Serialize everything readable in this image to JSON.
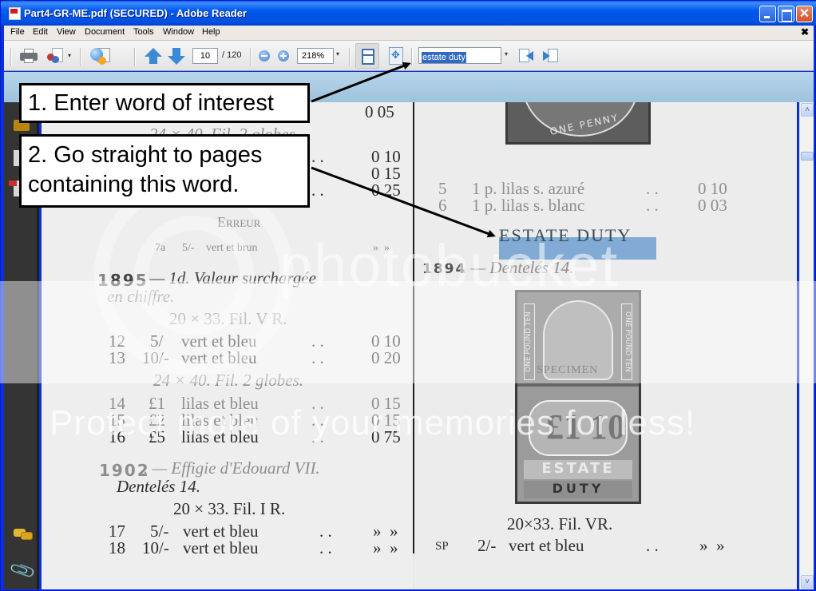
{
  "window": {
    "title": "Part4-GR-ME.pdf (SECURED) - Adobe Reader",
    "controls": [
      "minimize",
      "maximize",
      "close"
    ],
    "close_glyph": "✕"
  },
  "menubar": {
    "items": [
      "File",
      "Edit",
      "View",
      "Document",
      "Tools",
      "Window",
      "Help"
    ],
    "doc_close_glyph": "✖"
  },
  "toolbar": {
    "current_page": "10",
    "total_pages": "/ 120",
    "zoom_level": "218%",
    "search_value": "estate duty",
    "dropdown_glyph": "▾",
    "icons": [
      "printer-icon",
      "collaborate-icon",
      "secure-globe-icon",
      "previous-page-icon",
      "next-page-icon",
      "zoom-out-icon",
      "zoom-in-icon",
      "fit-width-icon",
      "full-screen-icon",
      "find-previous-icon",
      "find-next-icon"
    ]
  },
  "leftnav": {
    "icons": [
      "lock-icon",
      "pages-icon",
      "pdf-signature-icon",
      "comments-icon",
      "attachments-icon"
    ],
    "attach_glyph": "📎"
  },
  "document": {
    "left_column": {
      "top_price": "0 05",
      "partial_heading": "24 × 40. Fil. 2 globes.",
      "prices_a": [
        "0 10",
        "0 15",
        "0 25"
      ],
      "dots": ". .",
      "erreur": "Erreur",
      "row_7a": {
        "num": "7a",
        "value": "5/-",
        "desc": "vert et brun",
        "price": "»  »"
      },
      "heading_1895_year": "1895",
      "heading_1895_rest": ". — 1d. Valeur surchargée",
      "heading_1895_line2": "en chiffre.",
      "sub_1": "20 × 33. Fil. V R.",
      "rows_1": [
        {
          "num": "12",
          "value": "5/",
          "desc": "vert et bleu",
          "dots": ". .",
          "price": "0 10"
        },
        {
          "num": "13",
          "value": "10/-",
          "desc": "vert et bleu",
          "dots": ". .",
          "price": "0 20"
        }
      ],
      "sub_2": "24 × 40. Fil. 2 globes.",
      "rows_2": [
        {
          "num": "14",
          "value": "£1",
          "desc": "lilas et bleu",
          "dots": ". .",
          "price": "0 15"
        },
        {
          "num": "15",
          "value": "£2",
          "desc": "lilas et bleu",
          "dots": ". .",
          "price": "0 15"
        },
        {
          "num": "16",
          "value": "£5",
          "desc": "lilas et bleu",
          "dots": ". .",
          "price": "0 75"
        }
      ],
      "heading_1902_year": "1902",
      "heading_1902_rest": ". — Effigie d'Edouard VII.",
      "heading_1902_line2": "Dentelés 14.",
      "sub_3": "20 × 33. Fil. I R.",
      "rows_3": [
        {
          "num": "17",
          "value": "5/-",
          "desc": "vert et bleu",
          "dots": ". .",
          "price": "»  »"
        },
        {
          "num": "18",
          "value": "10/-",
          "desc": "vert et bleu",
          "dots": ". .",
          "price": "»  »"
        }
      ]
    },
    "right_column": {
      "stamp1_label": "ONE PENNY",
      "rows_1": [
        {
          "num": "5",
          "desc": "1 p. lilas s. azuré",
          "dots": ". .",
          "price": "0 10"
        },
        {
          "num": "6",
          "desc": "1 p. lilas s. blanc",
          "dots": ". .",
          "price": "0 03"
        }
      ],
      "section_title": "ESTATE DUTY",
      "heading_1894_year": "1894",
      "heading_1894_rest": ". — Dentelés 14.",
      "stamp2": {
        "side_text": "ONE POUND TEN",
        "overprint": "SPECIMEN",
        "value": "£1 10",
        "line1": "ESTATE",
        "line2": "DUTY"
      },
      "sub_1": "20×33. Fil. VR.",
      "row_sp": {
        "num": "SP",
        "value": "2/-",
        "desc": "vert et bleu",
        "dots": ". .",
        "price": "»  »"
      }
    }
  },
  "watermark": {
    "logo": "photobucket",
    "tagline": "Protect more of your memories for less!"
  },
  "callouts": [
    {
      "text": "1. Enter word of interest"
    },
    {
      "text_line1": "2. Go straight to pages",
      "text_line2": "containing this word."
    }
  ],
  "scrollbar": {
    "up_glyph": "˄",
    "down_glyph": "˅"
  },
  "colors": {
    "titlebar": "#0058ee",
    "search_highlight": "#5e96cc",
    "selection": "#316ac5",
    "close_button": "#d4502c"
  }
}
